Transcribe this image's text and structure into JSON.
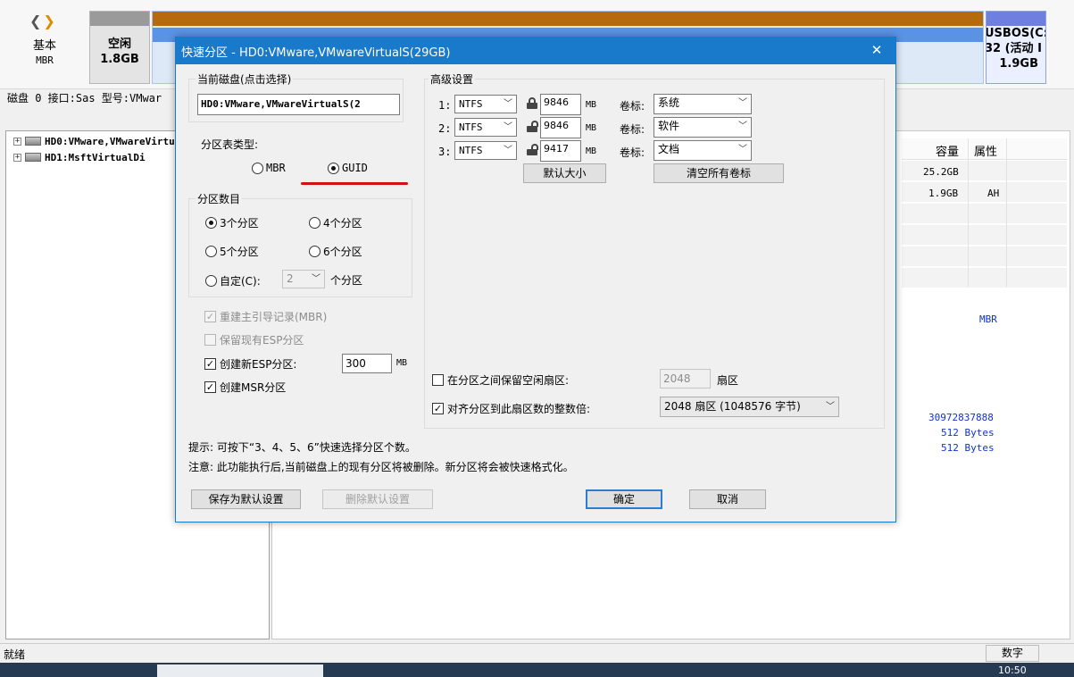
{
  "app": {
    "nav": {
      "back": "❮",
      "forward": "❯"
    },
    "disk_map": {
      "basic_label": "基本",
      "basic_sub": "MBR",
      "free_label": "空闲",
      "free_size": "1.8GB",
      "usb_line1": "USBOS(C:",
      "usb_line2": "32 (活动 I",
      "usb_size": "1.9GB"
    },
    "disk_info": "磁盘 0 接口:Sas  型号:VMwar",
    "tree": [
      {
        "label": "HD0:VMware,VMwareVirtualS"
      },
      {
        "label": "HD1:MsftVirtualDi"
      }
    ],
    "grid": {
      "columns": [
        "容量",
        "属性"
      ],
      "rows": [
        {
          "capacity": "25.2GB",
          "attr": ""
        },
        {
          "capacity": "1.9GB",
          "attr": "AH"
        }
      ]
    },
    "details": {
      "partition_style": "MBR",
      "total_sectors": "30972837888",
      "bytes_per_sector": "512 Bytes",
      "physical_sector": "512 Bytes"
    },
    "status": {
      "text": "就绪",
      "mode": "数字"
    },
    "clock": "10:50"
  },
  "dialog": {
    "title": "快速分区 - HD0:VMware,VMwareVirtualS(29GB)",
    "close": "✕",
    "current_disk": {
      "label": "当前磁盘(点击选择)",
      "value": "HD0:VMware,VMwareVirtualS(2"
    },
    "partition_table": {
      "label": "分区表类型:",
      "options": [
        "MBR",
        "GUID"
      ],
      "selected": "GUID"
    },
    "partition_count": {
      "label": "分区数目",
      "options": [
        "3个分区",
        "4个分区",
        "5个分区",
        "6个分区"
      ],
      "selected": "3个分区",
      "custom_label": "自定(C):",
      "custom_value": "2",
      "custom_suffix": "个分区"
    },
    "checks": {
      "rebuild_mbr": "重建主引导记录(MBR)",
      "keep_esp": "保留现有ESP分区",
      "create_esp": "创建新ESP分区:",
      "esp_size": "300",
      "esp_unit": "MB",
      "create_msr": "创建MSR分区"
    },
    "advanced": {
      "label": "高级设置",
      "partitions": [
        {
          "index": "1:",
          "fs": "NTFS",
          "size": "9846",
          "unit": "MB",
          "vol_label": "卷标:",
          "vol": "系统"
        },
        {
          "index": "2:",
          "fs": "NTFS",
          "size": "9846",
          "unit": "MB",
          "vol_label": "卷标:",
          "vol": "软件"
        },
        {
          "index": "3:",
          "fs": "NTFS",
          "size": "9417",
          "unit": "MB",
          "vol_label": "卷标:",
          "vol": "文档"
        }
      ],
      "default_size_btn": "默认大小",
      "clear_labels_btn": "清空所有卷标",
      "keep_free_label": "在分区之间保留空闲扇区:",
      "keep_free_value": "2048",
      "keep_free_unit": "扇区",
      "align_label": "对齐分区到此扇区数的整数倍:",
      "align_value": "2048 扇区 (1048576 字节)"
    },
    "hint": "提示: 可按下“3、4、5、6”快速选择分区个数。",
    "note": "注意: 此功能执行后,当前磁盘上的现有分区将被删除。新分区将会被快速格式化。",
    "buttons": {
      "save_default": "保存为默认设置",
      "delete_default": "删除默认设置",
      "ok": "确定",
      "cancel": "取消"
    }
  }
}
